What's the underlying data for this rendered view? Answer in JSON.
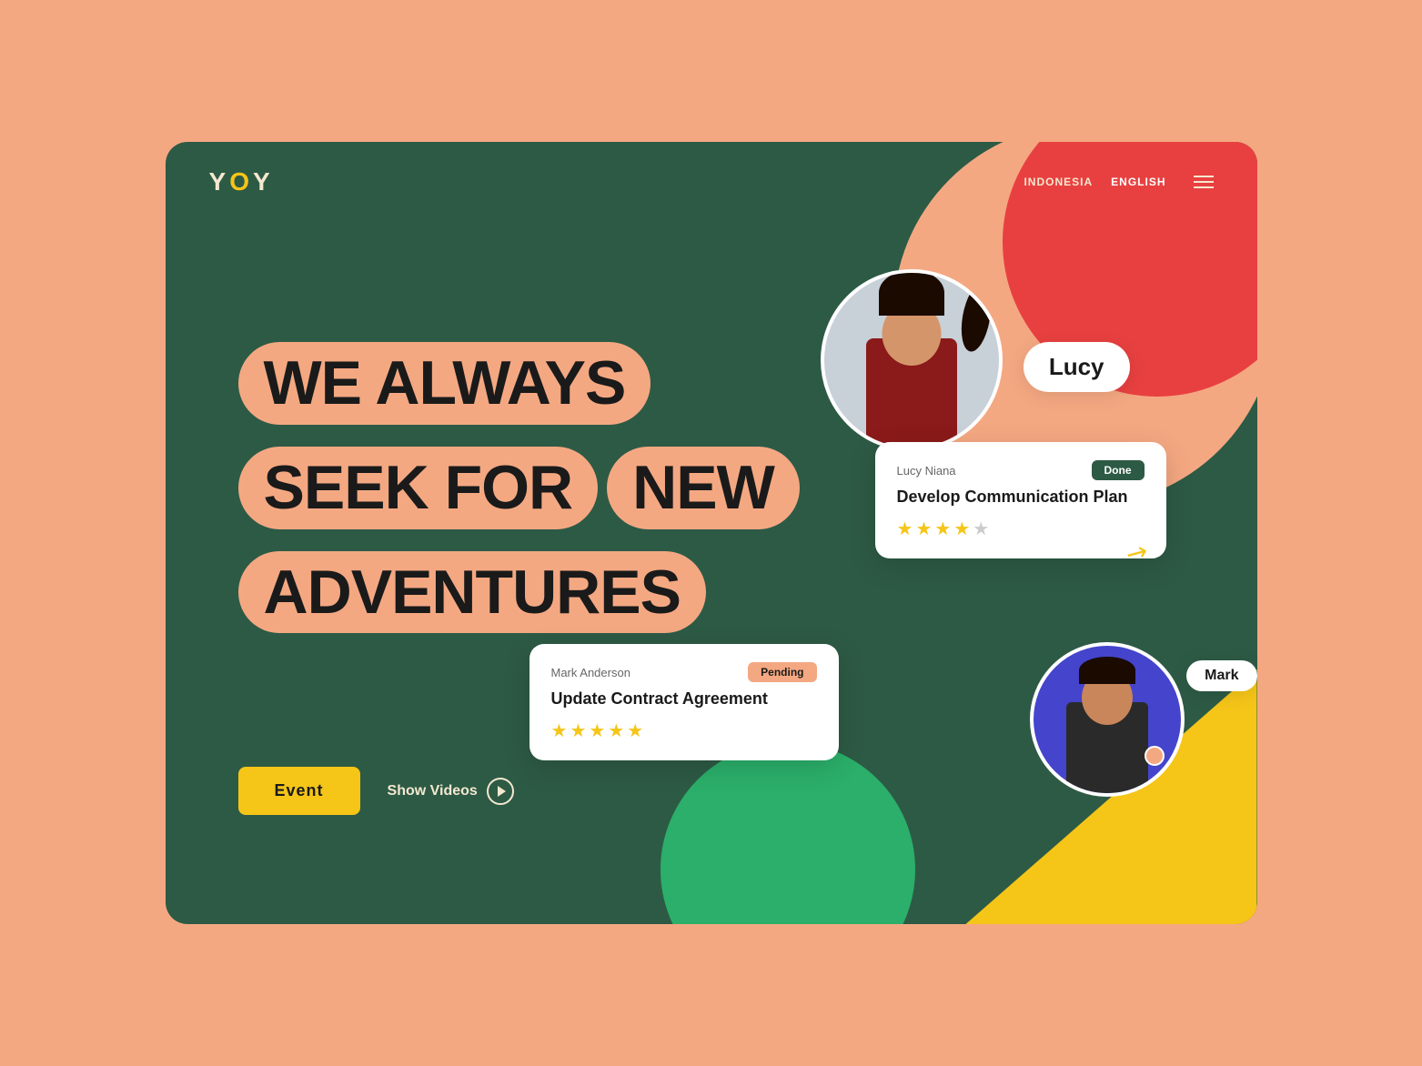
{
  "logo": {
    "text_y1": "Y",
    "text_o": "O",
    "text_y2": "Y"
  },
  "navbar": {
    "lang_indonesia": "INDONESIA",
    "lang_english": "ENGLISH"
  },
  "hero": {
    "line1": "WE  ALWAYS",
    "line2a": "SEEK FOR",
    "line2b": "NEW",
    "line3": "ADVENTURES"
  },
  "buttons": {
    "event_label": "Event",
    "show_videos_label": "Show Videos"
  },
  "lucy_card": {
    "name_badge": "Lucy",
    "task_person": "Lucy Niana",
    "task_title": "Develop Communication Plan",
    "badge": "Done",
    "stars_filled": 4,
    "stars_empty": 1
  },
  "mark_card": {
    "name_badge": "Mark",
    "task_person": "Mark Anderson",
    "task_title": "Update Contract Agreement",
    "badge": "Pending",
    "stars_filled": 5,
    "stars_empty": 0
  },
  "colors": {
    "bg_main": "#2D5A45",
    "bg_page": "#F4A882",
    "accent_yellow": "#F5C518",
    "accent_red": "#E84040",
    "accent_green": "#2BAF6A"
  }
}
